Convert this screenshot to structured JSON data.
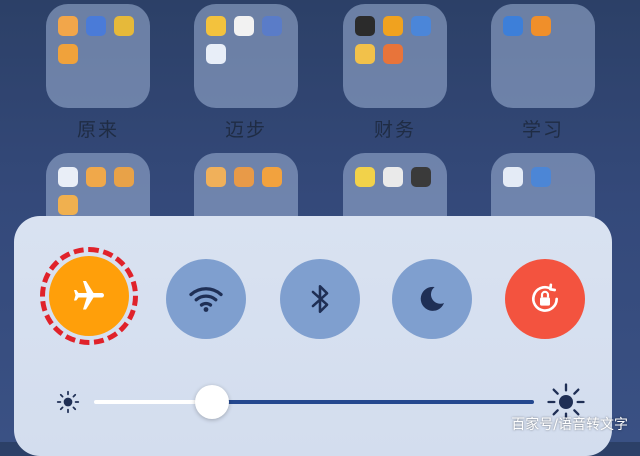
{
  "home": {
    "folders": [
      {
        "label": "原来"
      },
      {
        "label": "迈步"
      },
      {
        "label": "财务"
      },
      {
        "label": "学习"
      }
    ]
  },
  "control_center": {
    "toggles": [
      {
        "name": "airplane-mode",
        "icon": "airplane-icon",
        "state": "on",
        "color": "#ff9f0a"
      },
      {
        "name": "wifi",
        "icon": "wifi-icon",
        "state": "off"
      },
      {
        "name": "bluetooth",
        "icon": "bluetooth-icon",
        "state": "off"
      },
      {
        "name": "do-not-disturb",
        "icon": "moon-icon",
        "state": "off"
      },
      {
        "name": "rotation-lock",
        "icon": "rotation-lock-icon",
        "state": "on",
        "color": "#f3533f"
      }
    ],
    "brightness": {
      "level": 0.26,
      "min_icon": "sun-small-icon",
      "max_icon": "sun-large-icon"
    }
  },
  "watermark": "百家号/语音转文字"
}
